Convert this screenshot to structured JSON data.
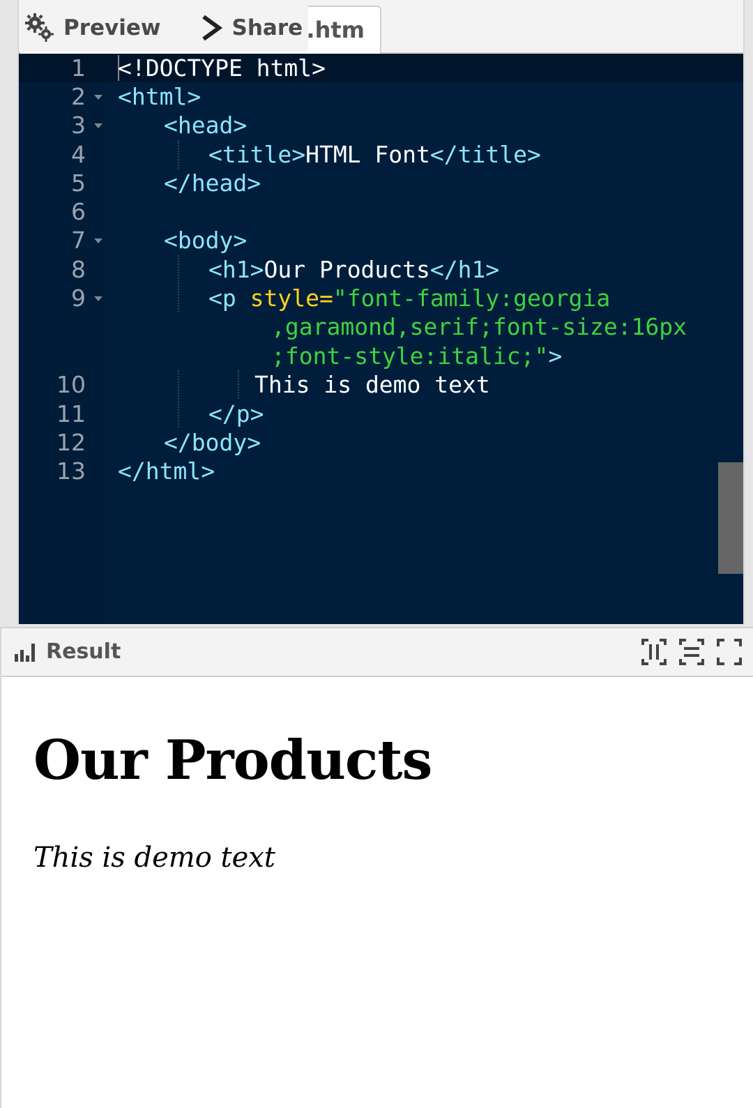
{
  "toolbar": {
    "preview_label": "Preview",
    "share_label": "Share",
    "file_tab_name": ".htm"
  },
  "editor": {
    "line_numbers": [
      "1",
      "2",
      "3",
      "4",
      "5",
      "6",
      "7",
      "8",
      "9",
      "10",
      "11",
      "12",
      "13"
    ],
    "code": {
      "l1": "<!DOCTYPE html>",
      "l2": "<html>",
      "l3": "<head>",
      "l4_open": "<title>",
      "l4_text": "HTML Font",
      "l4_close": "</title>",
      "l5": "</head>",
      "l7": "<body>",
      "l8_open": "<h1>",
      "l8_text": "Our Products",
      "l8_close": "</h1>",
      "l9_tag": "<p ",
      "l9_attr": "style=",
      "l9_str": "\"font-family:georgia",
      "l9b_str": ",garamond,serif;font-size:16px",
      "l9c_str": ";font-style:italic;\"",
      "l9c_end": ">",
      "l10_text": "This is demo text",
      "l11": "</p>",
      "l12": "</body>",
      "l13": "</html>"
    }
  },
  "result": {
    "title": "Result",
    "preview": {
      "heading": "Our Products",
      "paragraph": "This is demo text"
    }
  },
  "colors": {
    "editor_bg": "#001e3c",
    "tag": "#8ce4ff",
    "attribute": "#ffd21e",
    "string": "#3fd23f"
  },
  "icons": {
    "preview": "gear-icon",
    "share": "chevron-right-icon",
    "result": "bar-chart-icon",
    "actions": [
      "split-vertical-icon",
      "split-horizontal-icon",
      "fullscreen-icon"
    ]
  }
}
